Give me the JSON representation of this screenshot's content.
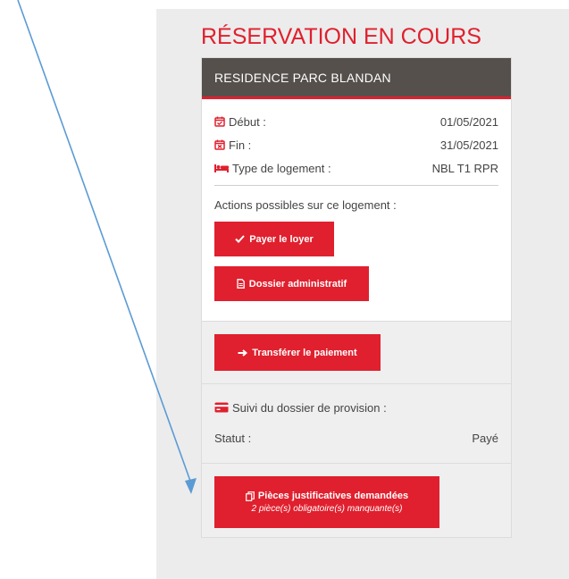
{
  "header": {
    "title": "RÉSERVATION EN COURS"
  },
  "residence": {
    "name": "RESIDENCE PARC BLANDAN"
  },
  "details": {
    "debut_label": "Début :",
    "debut_value": "01/05/2021",
    "fin_label": "Fin :",
    "fin_value": "31/05/2021",
    "type_label": "Type de logement :",
    "type_value": "NBL T1 RPR"
  },
  "actions": {
    "title": "Actions possibles sur ce logement :",
    "pay_label": "Payer le loyer",
    "dossier_label": "Dossier administratif",
    "transfer_label": "Transférer le paiement"
  },
  "suivi": {
    "title": "Suivi du dossier de provision :",
    "statut_label": "Statut :",
    "statut_value": "Payé"
  },
  "pieces": {
    "label": "Pièces justificatives demandées",
    "sublabel": "2 pièce(s) obligatoire(s) manquante(s)"
  },
  "colors": {
    "accent": "#e0202e",
    "header_bg": "#55504c",
    "panel_bg": "#ececec",
    "annotation_arrow": "#5b9bd5"
  },
  "icons": {
    "debut": "calendar-check-icon",
    "fin": "calendar-x-icon",
    "type": "bed-icon",
    "pay": "check-icon",
    "dossier": "document-icon",
    "transfer": "arrow-right-icon",
    "suivi": "credit-card-icon",
    "pieces": "copy-icon"
  }
}
